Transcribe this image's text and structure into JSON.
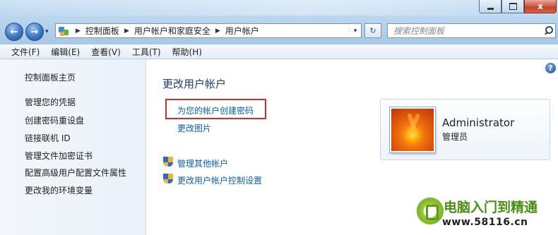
{
  "window": {
    "minimize_glyph": "",
    "maximize_glyph": "",
    "close_glyph": "x"
  },
  "nav": {
    "back_glyph": "←",
    "forward_glyph": "→",
    "history_glyph": "▾"
  },
  "address": {
    "separator": "▶",
    "breadcrumbs": [
      "控制面板",
      "用户帐户和家庭安全",
      "用户帐户"
    ],
    "dropdown_glyph": "▾"
  },
  "refresh": {
    "glyph": "↻"
  },
  "search": {
    "placeholder": "搜索控制面板"
  },
  "menubar": {
    "items": [
      "文件(F)",
      "编辑(E)",
      "查看(V)",
      "工具(T)",
      "帮助(H)"
    ]
  },
  "sidebar": {
    "home": "控制面板主页",
    "items": [
      "管理您的凭据",
      "创建密码重设盘",
      "链接联机 ID",
      "管理文件加密证书",
      "配置高级用户配置文件属性",
      "更改我的环境变量"
    ]
  },
  "main": {
    "help_glyph": "?",
    "title": "更改用户帐户",
    "links": [
      "为您的帐户创建密码",
      "更改图片"
    ],
    "admin_links": [
      "管理其他帐户",
      "更改用户帐户控制设置"
    ]
  },
  "user_card": {
    "name": "Administrator",
    "role": "管理员"
  },
  "watermark": {
    "title": "电脑入门到精通",
    "url": "www.58116.cn"
  },
  "colors": {
    "link": "#0b5fb5",
    "title": "#1e3a6e",
    "highlight_border": "#cc2e2e"
  }
}
